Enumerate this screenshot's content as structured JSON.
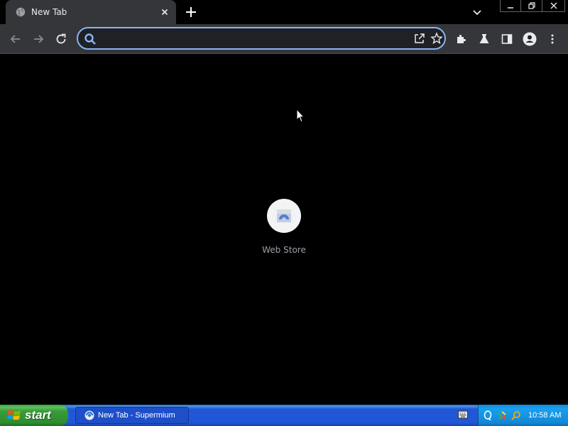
{
  "browser": {
    "tab": {
      "title": "New Tab"
    },
    "omnibox": {
      "value": "",
      "placeholder": ""
    }
  },
  "new_tab_page": {
    "shortcuts": [
      {
        "label": "Web Store",
        "icon": "web-store-icon"
      }
    ]
  },
  "taskbar": {
    "start_label": "start",
    "task_button_label": "New Tab - Supermium",
    "clock": "10:58 AM"
  },
  "colors": {
    "tab_background": "#35363a",
    "omnibox_focus": "#8ab4f8",
    "page_background": "#000000",
    "taskbar_blue": "#2157d7",
    "start_green": "#3a9a3a",
    "tray_blue": "#1188d6"
  }
}
